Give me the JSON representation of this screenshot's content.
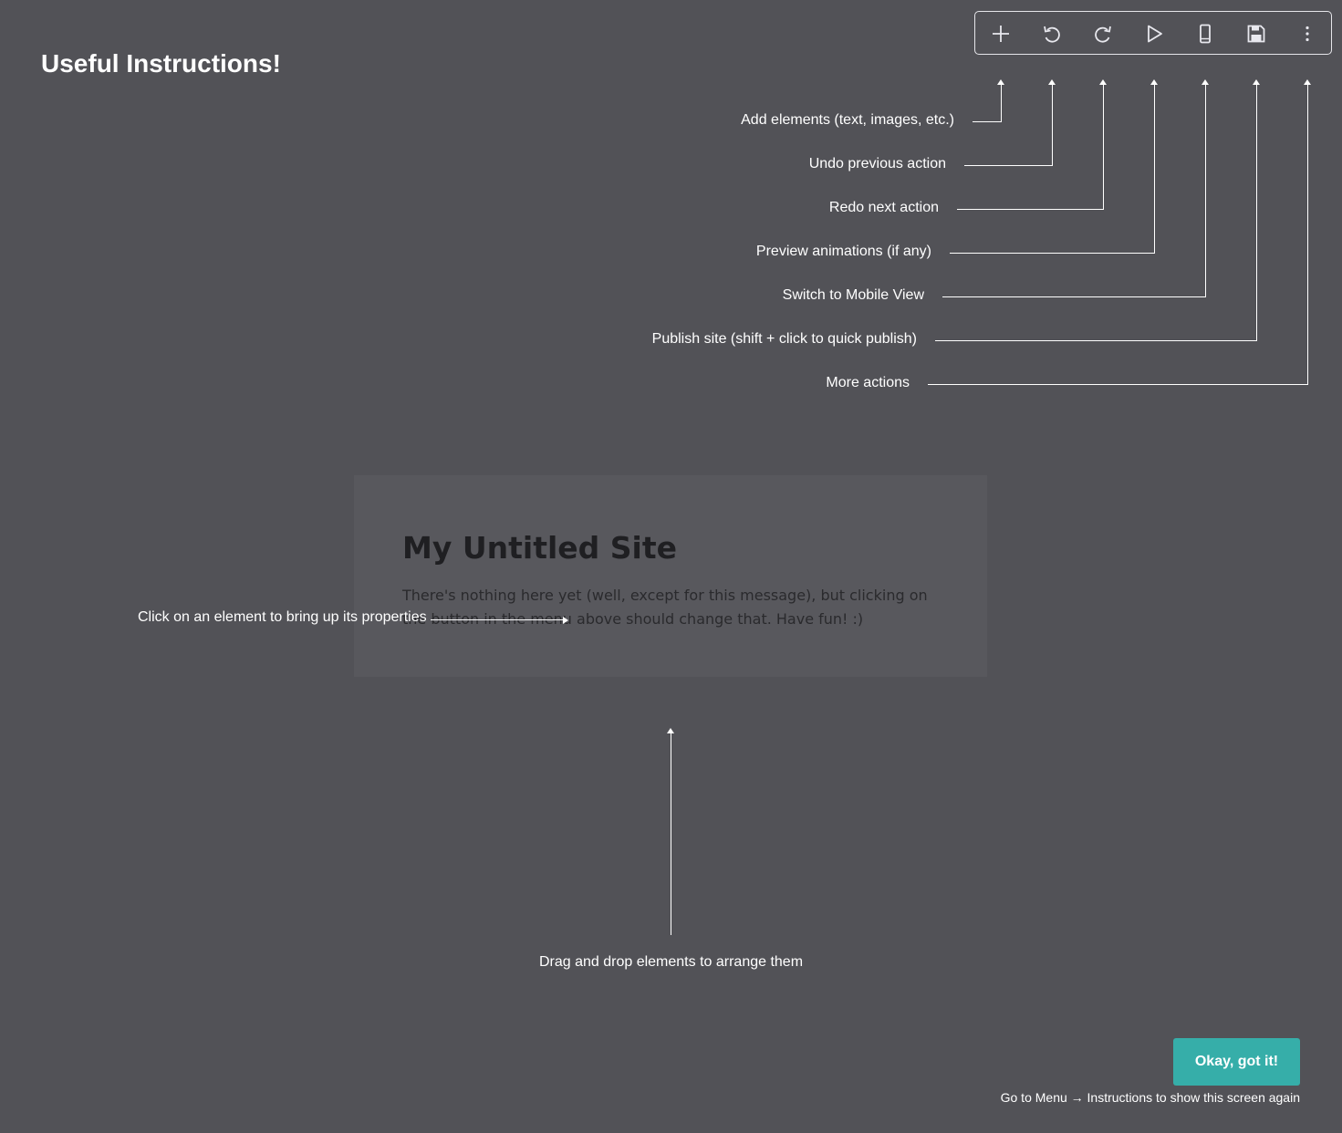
{
  "page": {
    "title": "Useful Instructions!"
  },
  "toolbar": {
    "buttons": [
      {
        "name": "add-icon",
        "hint": "Add elements (text, images, etc.)"
      },
      {
        "name": "undo-icon",
        "hint": "Undo previous action"
      },
      {
        "name": "redo-icon",
        "hint": "Redo next action"
      },
      {
        "name": "play-icon",
        "hint": "Preview animations (if any)"
      },
      {
        "name": "mobile-icon",
        "hint": "Switch to Mobile View"
      },
      {
        "name": "save-icon",
        "hint": "Publish site (shift + click to quick publish)"
      },
      {
        "name": "more-vertical-icon",
        "hint": "More actions"
      }
    ]
  },
  "site": {
    "title": "My Untitled Site",
    "body": "There's nothing here yet (well, except for this message), but clicking on the button in the menu above should change that. Have fun! :)"
  },
  "hints": {
    "click_element": "Click on an element to bring up its properties",
    "drag_drop": "Drag and drop elements to arrange them"
  },
  "footer": {
    "ok_label": "Okay, got it!",
    "reminder": "Go to Menu → Instructions to show this screen again"
  },
  "colors": {
    "background": "#525257",
    "card": "#58585d",
    "accent": "#36aea9",
    "text": "#ffffff"
  }
}
